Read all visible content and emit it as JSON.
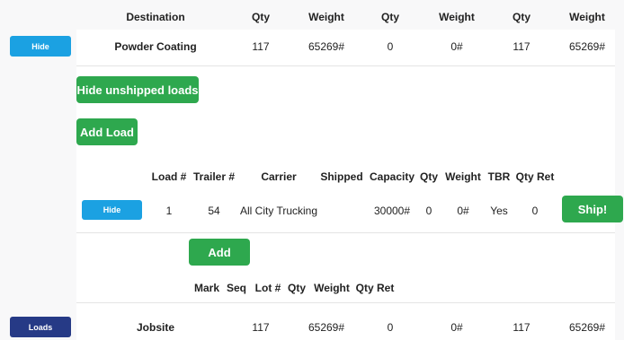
{
  "summary_header": {
    "destination": "Destination",
    "qty1": "Qty",
    "weight1": "Weight",
    "qty2": "Qty",
    "weight2": "Weight",
    "qty3": "Qty",
    "weight3": "Weight"
  },
  "row1": {
    "button": "Hide",
    "destination": "Powder Coating",
    "qty1": "117",
    "weight1": "65269#",
    "qty2": "0",
    "weight2": "0#",
    "qty3": "117",
    "weight3": "65269#"
  },
  "actions": {
    "hide_unshipped": "Hide unshipped loads",
    "add_load": "Add Load"
  },
  "loads_header": {
    "load_num": "Load #",
    "trailer_num": "Trailer #",
    "carrier": "Carrier",
    "shipped": "Shipped",
    "capacity": "Capacity",
    "qty": "Qty",
    "weight": "Weight",
    "tbr": "TBR",
    "qty_ret": "Qty Ret"
  },
  "load_row": {
    "button": "Hide",
    "load_num": "1",
    "trailer_num": "54",
    "carrier": "All City Trucking",
    "shipped": "",
    "capacity": "30000#",
    "qty": "0",
    "weight": "0#",
    "tbr": "Yes",
    "qty_ret": "0",
    "ship_button": "Ship!"
  },
  "add_button": "Add",
  "items_header": {
    "mark": "Mark",
    "seq": "Seq",
    "lot_num": "Lot #",
    "qty": "Qty",
    "weight": "Weight",
    "qty_ret": "Qty Ret"
  },
  "row2": {
    "button": "Loads",
    "destination": "Jobsite",
    "qty1": "117",
    "weight1": "65269#",
    "qty2": "0",
    "weight2": "0#",
    "qty3": "117",
    "weight3": "65269#"
  },
  "colors": {
    "blue": "#1ba1e2",
    "navy": "#263a86",
    "green": "#2ea84e",
    "band": "#f8f8f9"
  }
}
